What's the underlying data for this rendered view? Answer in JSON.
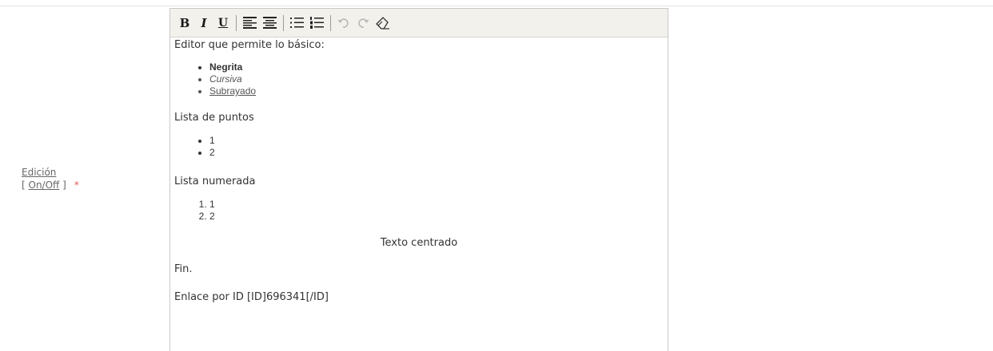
{
  "field": {
    "label": "Edición",
    "toggle_open": "[ ",
    "toggle_link": "On/Off",
    "toggle_close": " ]",
    "required_mark": "*"
  },
  "toolbar": {
    "bold": "B",
    "italic": "I",
    "underline": "U"
  },
  "content": {
    "intro": "Editor que permite lo básico:",
    "format_items": [
      "Negrita",
      "Cursiva",
      "Subrayado"
    ],
    "bullet_heading": "Lista de puntos",
    "bullet_items": [
      "1",
      "2"
    ],
    "numbered_heading": "Lista numerada",
    "numbered_items": [
      "1",
      "2"
    ],
    "centered": "Texto centrado",
    "end": "Fin.",
    "link_line": "Enlace por ID [ID]696341[/ID]"
  },
  "colors": {
    "toolbar_bg": "#f3f1ec",
    "required": "#e05a5a",
    "border": "#c9c9c9"
  }
}
